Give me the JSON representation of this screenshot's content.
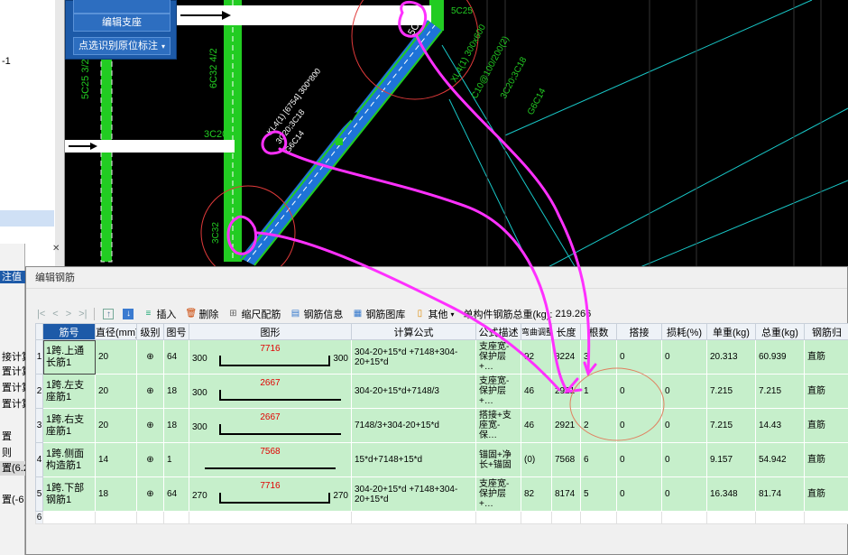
{
  "left_panel": {
    "lines": [
      "-1"
    ]
  },
  "cad_toolbar": {
    "buttons": [
      {
        "label": "编辑支座"
      },
      {
        "label": "点选识别原位标注",
        "caret": "▾"
      }
    ]
  },
  "cad_labels": {
    "c1": "5C25 3/2",
    "c2": "6C32 4/2",
    "c3": "3C20",
    "c4": "5C20",
    "c5": "3C32",
    "beam1": "KL4(1) [6754] 300*800",
    "beam2": "3C20;3C18",
    "beam3": "G6C14",
    "beam4": "XL4(1) 300x600",
    "beam5": "C10@100/200(2)",
    "beam6": "3C20;3C18",
    "beam7": "G6C14",
    "beam8": "5C25"
  },
  "left_remnant": {
    "header": "注值",
    "items": [
      "接计算",
      "置计算",
      "置计算",
      "置计算",
      "置",
      "则",
      "置(6.2",
      "置(-6"
    ]
  },
  "edit_window": {
    "title": "编辑钢筋",
    "toolbar": {
      "nav": [
        "|<",
        "<",
        ">",
        ">|"
      ],
      "insert": "插入",
      "delete": "删除",
      "scale": "缩尺配筋",
      "info": "钢筋信息",
      "library": "钢筋图库",
      "other": "其他",
      "total_label": "单构件钢筋总重(kg):",
      "total_value": "219.266"
    },
    "columns": [
      "筋号",
      "直径(mm)",
      "级别",
      "图号",
      "图形",
      "计算公式",
      "公式描述",
      "弯曲调整",
      "长度",
      "根数",
      "搭接",
      "损耗(%)",
      "单重(kg)",
      "总重(kg)",
      "钢筋归"
    ],
    "rows": [
      {
        "num": "1",
        "name": "1跨.上通长筋1",
        "dia": "20",
        "grade": "⊕",
        "fig": "64",
        "left": "300",
        "value": "7716",
        "right": "300",
        "formula": "304-20+15*d +7148+304-20+15*d",
        "desc": "支座宽-保护层+…",
        "bend": "92",
        "length": "8224",
        "count": "3",
        "lap": "0",
        "loss": "0",
        "unit": "20.313",
        "total": "60.939",
        "type": "直筋"
      },
      {
        "num": "2",
        "name": "1跨.左支座筋1",
        "dia": "20",
        "grade": "⊕",
        "fig": "18",
        "left": "300",
        "value": "2667",
        "right": "",
        "formula": "304-20+15*d+7148/3",
        "desc": "支座宽-保护层+…",
        "bend": "46",
        "length": "2921",
        "count": "1",
        "lap": "0",
        "loss": "0",
        "unit": "7.215",
        "total": "7.215",
        "type": "直筋"
      },
      {
        "num": "3",
        "name": "1跨.右支座筋1",
        "dia": "20",
        "grade": "⊕",
        "fig": "18",
        "left": "300",
        "value": "2667",
        "right": "",
        "formula": "7148/3+304-20+15*d",
        "desc": "搭接+支座宽-保…",
        "bend": "46",
        "length": "2921",
        "count": "2",
        "lap": "0",
        "loss": "0",
        "unit": "7.215",
        "total": "14.43",
        "type": "直筋"
      },
      {
        "num": "4",
        "name": "1跨.侧面构造筋1",
        "dia": "14",
        "grade": "⊕",
        "fig": "1",
        "left": "",
        "value": "7568",
        "right": "",
        "formula": "15*d+7148+15*d",
        "desc": "锚固+净长+锚固",
        "bend": "(0)",
        "length": "7568",
        "count": "6",
        "lap": "0",
        "loss": "0",
        "unit": "9.157",
        "total": "54.942",
        "type": "直筋"
      },
      {
        "num": "5",
        "name": "1跨.下部钢筋1",
        "dia": "18",
        "grade": "⊕",
        "fig": "64",
        "left": "270",
        "value": "7716",
        "right": "270",
        "formula": "304-20+15*d +7148+304-20+15*d",
        "desc": "支座宽-保护层+…",
        "bend": "82",
        "length": "8174",
        "count": "5",
        "lap": "0",
        "loss": "0",
        "unit": "16.348",
        "total": "81.74",
        "type": "直筋"
      }
    ],
    "empty_row_num": "6"
  },
  "colors": {
    "annotation": "#ff30ff",
    "beam_green": "#22cc22",
    "beam_blue": "#1e73d8",
    "circle_red": "#e03a3a",
    "row_green": "#c6efcb"
  }
}
